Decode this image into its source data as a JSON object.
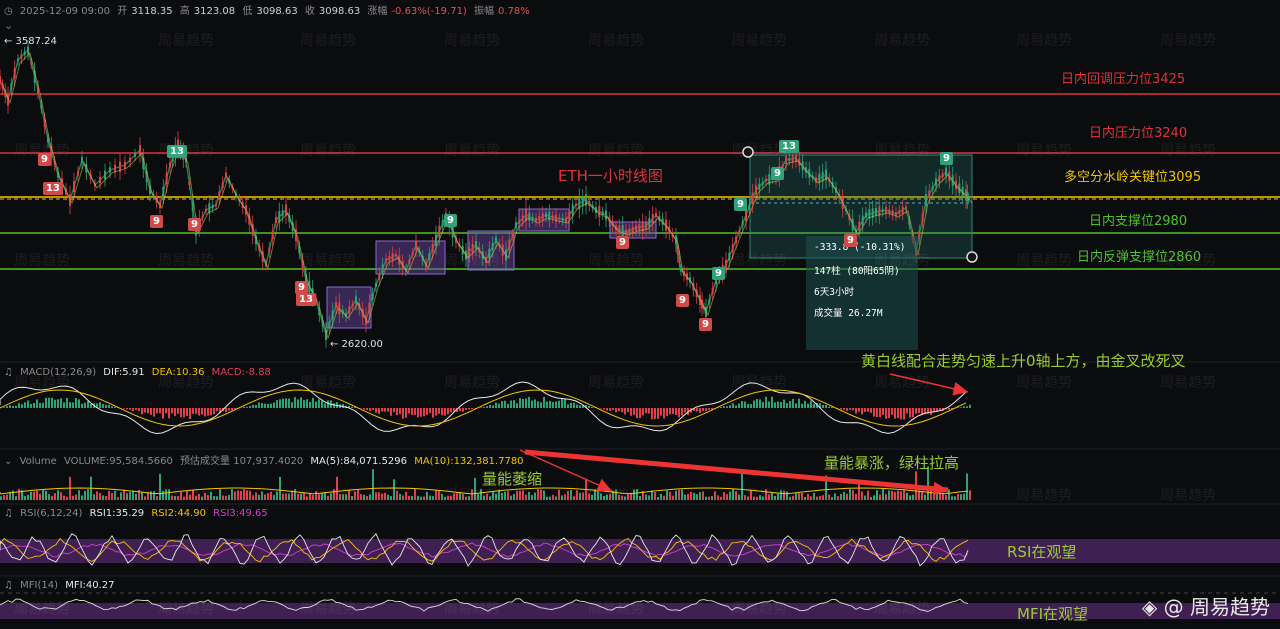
{
  "header": {
    "datetime": "2025-12-09 09:00",
    "open_label": "开",
    "open": "3118.35",
    "high_label": "高",
    "high": "3123.08",
    "low_label": "低",
    "low": "3098.63",
    "close_label": "收",
    "close": "3098.63",
    "change_label": "涨幅",
    "change": "-0.63%(-19.71)",
    "amplitude_label": "振幅",
    "amplitude": "0.78%"
  },
  "price_marks": {
    "high_mark": "← 3587.24",
    "low_mark": "← 2620.00"
  },
  "levels": [
    {
      "label": "日内回调压力位3425",
      "color": "#e0313a"
    },
    {
      "label": "日内压力位3240",
      "color": "#e0313a"
    },
    {
      "label": "多空分水岭关键位3095",
      "color": "#f2c400"
    },
    {
      "label": "日内支撑位2980",
      "color": "#4cc22a"
    },
    {
      "label": "日内反弹支撑位2860",
      "color": "#4cc22a"
    }
  ],
  "chart_title": "ETH一小时线图",
  "badges": [
    {
      "text": "9",
      "type": "r"
    },
    {
      "text": "13",
      "type": "r"
    },
    {
      "text": "13",
      "type": "g"
    },
    {
      "text": "9",
      "type": "r"
    },
    {
      "text": "9",
      "type": "r"
    },
    {
      "text": "9",
      "type": "r"
    },
    {
      "text": "13",
      "type": "r"
    },
    {
      "text": "9",
      "type": "g"
    },
    {
      "text": "9",
      "type": "r"
    },
    {
      "text": "9",
      "type": "r"
    },
    {
      "text": "9",
      "type": "r"
    },
    {
      "text": "9",
      "type": "g"
    },
    {
      "text": "9",
      "type": "g"
    },
    {
      "text": "9",
      "type": "g"
    },
    {
      "text": "13",
      "type": "g"
    },
    {
      "text": "9",
      "type": "r"
    },
    {
      "text": "9",
      "type": "g"
    }
  ],
  "measure_box": {
    "change": "-333.8 (-10.31%)",
    "bars": "147柱 (80阳65阴)",
    "duration": "6天3小时",
    "volume": "成交量 26.27M"
  },
  "annotations": {
    "macd_note": "黄白线配合走势匀速上升0轴上方，由金叉改死叉",
    "volume_shrink": "量能萎缩",
    "volume_surge": "量能暴涨，绿柱拉高",
    "rsi_note": "RSI在观望",
    "mfi_note": "MFI在观望"
  },
  "macd": {
    "title": "MACD(12,26,9)",
    "dif": "DIF:5.91",
    "dea": "DEA:10.36",
    "macd": "MACD:-8.88"
  },
  "volume": {
    "title": "Volume",
    "volume": "VOLUME:95,584.5660",
    "est": "预估成交量 107,937.4020",
    "ma5": "MA(5):84,071.5296",
    "ma10": "MA(10):132,381.7780"
  },
  "rsi": {
    "title": "RSI(6,12,24)",
    "rsi1": "RSI1:35.29",
    "rsi2": "RSI2:44.90",
    "rsi3": "RSI3:49.65"
  },
  "mfi": {
    "title": "MFI(14)",
    "mfi": "MFI:40.27"
  },
  "watermark": "周易趋势",
  "brand": "◈ @ 周易趋势",
  "colors": {
    "up": "#2ea37a",
    "down": "#e0404a",
    "yellow": "#f2c400",
    "panel_band": "#5a2a70"
  },
  "icons": [
    "expand-icon",
    "bell-icon"
  ]
}
